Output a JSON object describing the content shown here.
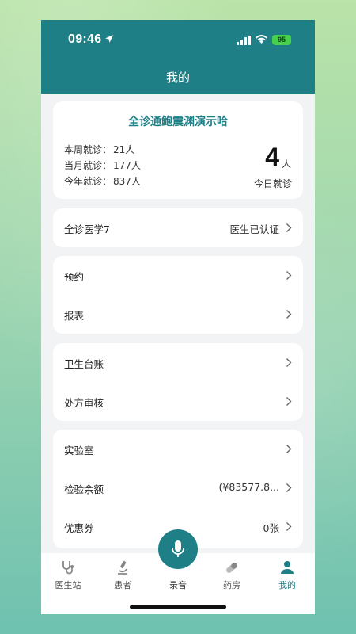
{
  "status_bar": {
    "time": "09:46",
    "battery": "95"
  },
  "header": {
    "title": "我的"
  },
  "stats_card": {
    "clinic_name": "全诊通鲍震渊演示哈",
    "lines": [
      {
        "label": "本周就诊：",
        "value": "21人"
      },
      {
        "label": "当月就诊：",
        "value": "177人"
      },
      {
        "label": "今年就诊：",
        "value": "837人"
      }
    ],
    "today_count": "4",
    "today_unit": "人",
    "today_label": "今日就诊"
  },
  "doctor_card": {
    "name": "全诊医学7",
    "status": "医生已认证"
  },
  "menu_group1": [
    {
      "label": "预约"
    },
    {
      "label": "报表"
    }
  ],
  "menu_group2": [
    {
      "label": "卫生台账"
    },
    {
      "label": "处方审核"
    }
  ],
  "menu_group3": [
    {
      "label": "实验室",
      "value": ""
    },
    {
      "label": "检验余额",
      "value": "(¥83577.8..."
    },
    {
      "label": "优惠券",
      "value": "0张"
    }
  ],
  "tabbar": {
    "tabs": [
      {
        "label": "医生站",
        "icon": "stethoscope-icon"
      },
      {
        "label": "患者",
        "icon": "microscope-icon"
      },
      {
        "label": "录音",
        "icon": "microphone-icon"
      },
      {
        "label": "药房",
        "icon": "pill-icon"
      },
      {
        "label": "我的",
        "icon": "person-icon"
      }
    ]
  },
  "colors": {
    "primary": "#1f7f86",
    "battery": "#47d14a"
  }
}
